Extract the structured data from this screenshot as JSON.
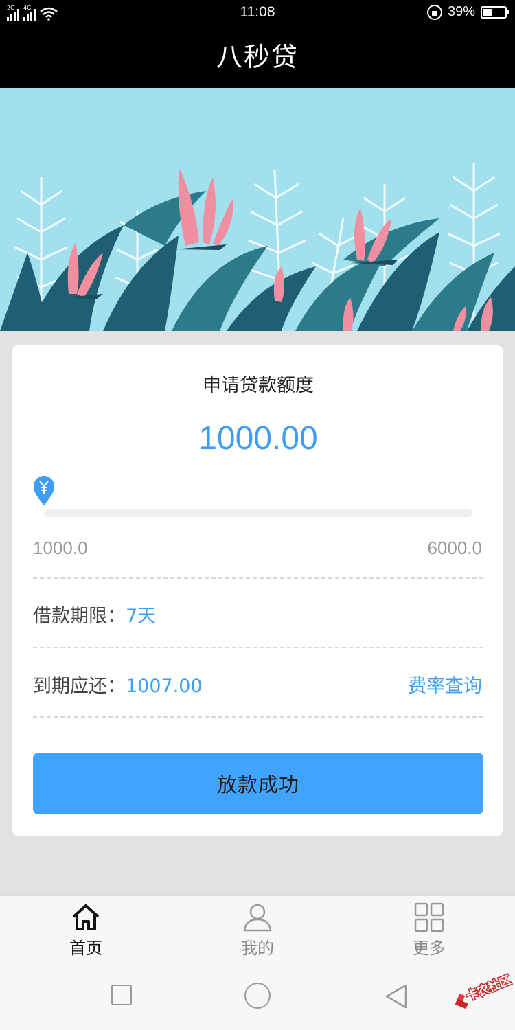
{
  "status_bar": {
    "time": "11:08",
    "signal_tags": [
      "2G",
      "4G"
    ],
    "battery_percent": "39%",
    "battery_level": 0.39
  },
  "app": {
    "title": "八秒贷"
  },
  "banner": {
    "slide_count": 2,
    "active_slide": 2
  },
  "loan": {
    "section_title": "申请贷款额度",
    "amount": "1000.00",
    "range_min": "1000.0",
    "range_max": "6000.0",
    "slider_fraction": 0,
    "slider_icon": "yuan-icon",
    "term_label": "借款期限：",
    "term_value": "7天",
    "due_label": "到期应还：",
    "due_value": "1007.00",
    "rate_link": "费率查询",
    "submit_label": "放款成功"
  },
  "tabs": [
    {
      "label": "首页",
      "icon": "home-icon",
      "active": true
    },
    {
      "label": "我的",
      "icon": "user-icon",
      "active": false
    },
    {
      "label": "更多",
      "icon": "grid-icon",
      "active": false
    }
  ],
  "watermark": {
    "text": "卡农社区"
  },
  "colors": {
    "accent": "#3e9ef3",
    "button": "#42a3fd",
    "banner_bg": "#a2e0ee"
  }
}
